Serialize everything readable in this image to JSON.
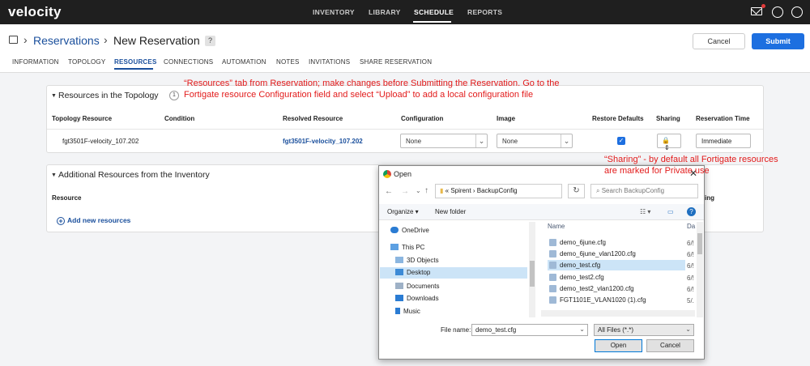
{
  "app": {
    "logo": "velocity",
    "nav": [
      "INVENTORY",
      "LIBRARY",
      "SCHEDULE",
      "REPORTS"
    ]
  },
  "header": {
    "breadcrumb": "Reservations",
    "title": "New Reservation",
    "help": "?",
    "cancel": "Cancel",
    "submit": "Submit"
  },
  "tabs": [
    "INFORMATION",
    "TOPOLOGY",
    "RESOURCES",
    "CONNECTIONS",
    "AUTOMATION",
    "NOTES",
    "INVITATIONS",
    "SHARE RESERVATION"
  ],
  "topology_panel": {
    "title": "Resources in the Topology",
    "count": "1",
    "columns": [
      "Topology Resource",
      "Condition",
      "Resolved Resource",
      "Configuration",
      "Image",
      "Restore Defaults",
      "Sharing",
      "Reservation Time"
    ],
    "row": {
      "topology_resource": "fgt3501F-velocity_107.202",
      "condition": "",
      "resolved_resource": "fgt3501F-velocity_107.202",
      "configuration": "None",
      "image": "None",
      "restore_defaults": true,
      "reservation_time": "Immediate"
    }
  },
  "additional_panel": {
    "title": "Additional Resources from the Inventory",
    "columns": [
      "Resource",
      "ing"
    ],
    "add_link": "Add new resources"
  },
  "annotations": {
    "a1_line1": "“Resources” tab from Reservation; make changes before Submitting the Reservation. Go to the",
    "a1_line2": "Fortigate resource Configuration field and select “Upload” to add a local configuration file",
    "a2_line1": "“Sharing” - by default all Fortigate resources",
    "a2_line2": "are marked for Private use"
  },
  "dialog": {
    "title": "Open",
    "address": "« Spirent › BackupConfig",
    "search_placeholder": "Search BackupConfig",
    "organize": "Organize ▾",
    "new_folder": "New folder",
    "tree": [
      "OneDrive",
      "This PC",
      "3D Objects",
      "Desktop",
      "Documents",
      "Downloads",
      "Music"
    ],
    "col_name": "Name",
    "col_date": "Da",
    "files": [
      {
        "name": "demo_6june.cfg",
        "date": "6/!"
      },
      {
        "name": "demo_6june_vlan1200.cfg",
        "date": "6/!"
      },
      {
        "name": "demo_test.cfg",
        "date": "6/!"
      },
      {
        "name": "demo_test2.cfg",
        "date": "6/!"
      },
      {
        "name": "demo_test2_vlan1200.cfg",
        "date": "6/!"
      },
      {
        "name": "FGT1101E_VLAN1020 (1).cfg",
        "date": "5/."
      }
    ],
    "file_name_label": "File name:",
    "file_name_value": "demo_test.cfg",
    "file_type": "All Files (*.*)",
    "open_button": "Open",
    "cancel_button": "Cancel"
  }
}
